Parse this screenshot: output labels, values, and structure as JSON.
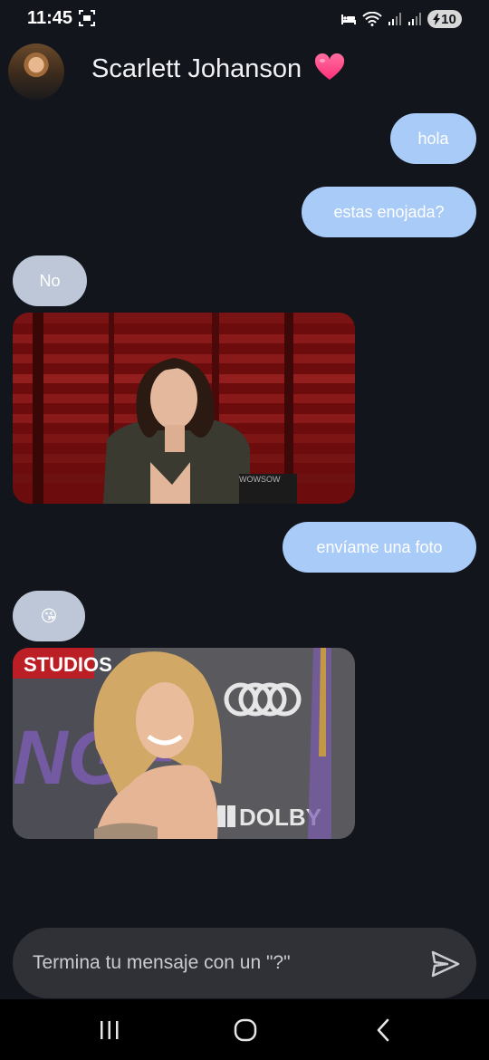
{
  "status_bar": {
    "time": "11:45",
    "battery": "10"
  },
  "contact": {
    "name": "Scarlett Johanson",
    "heart_icon": "pink-heart-icon"
  },
  "messages": [
    {
      "from": "me",
      "text": "hola"
    },
    {
      "from": "me",
      "text": "estas enojada?"
    },
    {
      "from": "contact",
      "text": "No"
    },
    {
      "from": "contact",
      "type": "image",
      "text_in_image": "WOWSOW"
    },
    {
      "from": "me",
      "text": "envíame una foto"
    },
    {
      "from": "contact",
      "text": "😘"
    },
    {
      "from": "contact",
      "type": "image",
      "text_in_image": [
        "STUDIOS",
        "NGE",
        "DOLBY"
      ]
    }
  ],
  "composer": {
    "placeholder": "Termina tu mensaje con un \"?\""
  },
  "colors": {
    "background": "#12151b",
    "sent_bubble": "#a9cbf7",
    "received_bubble": "#bdc7d7",
    "composer": "#2f3137"
  },
  "icons": {
    "send": "send-icon",
    "recents": "recents-icon",
    "home": "home-icon",
    "back": "back-icon"
  }
}
